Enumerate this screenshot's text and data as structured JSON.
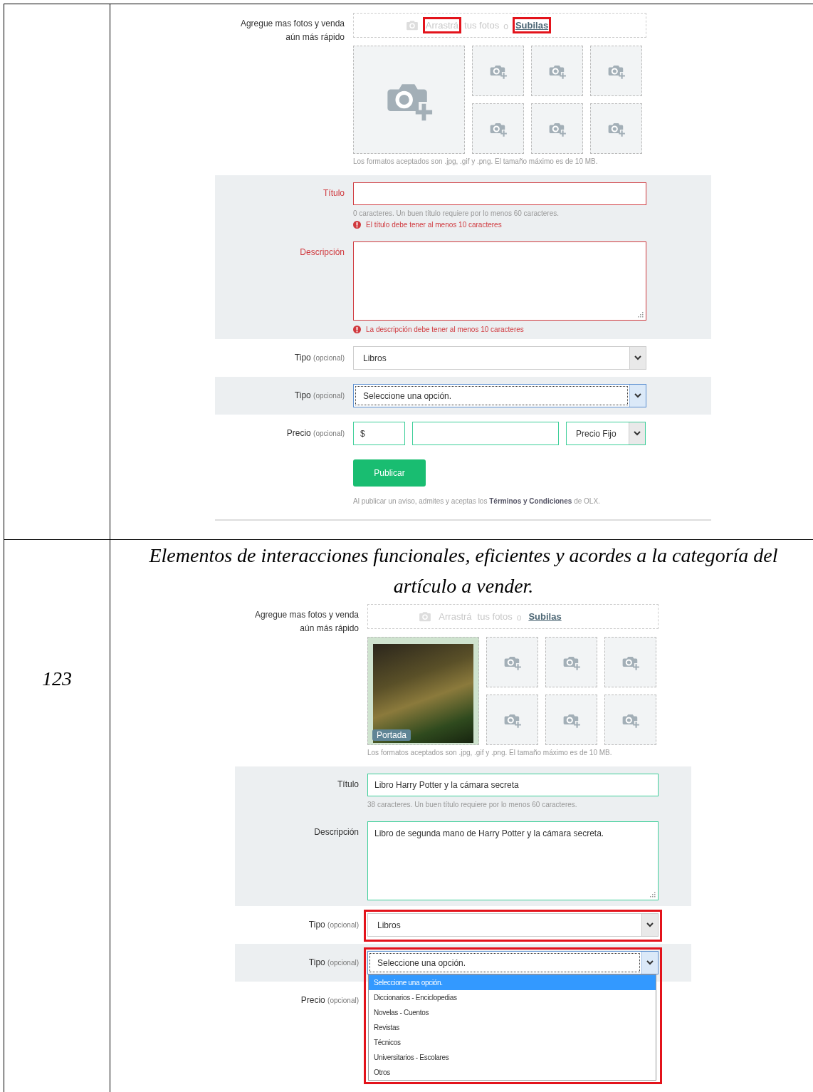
{
  "table": {
    "rows": [
      {
        "form": {
          "photos": {
            "label": "Agregue mas fotos y venda aún más rápido",
            "drop_word": "Arrastrá",
            "drop_rest": "tus fotos",
            "drop_highlighted": true,
            "or": "o",
            "upload_link": "Subilas",
            "upload_highlighted": true,
            "slots": [
              {
                "kind": "empty"
              },
              {
                "kind": "empty"
              },
              {
                "kind": "empty"
              },
              {
                "kind": "empty"
              },
              {
                "kind": "empty"
              },
              {
                "kind": "empty"
              },
              {
                "kind": "empty"
              }
            ],
            "hint": "Los formatos aceptados son .jpg, .gif y .png. El tamaño máximo es de 10 MB."
          },
          "title": {
            "label": "Título",
            "invalid": true,
            "counter": "0 caracteres. Un buen título requiere por lo menos 60 caracteres.",
            "error": "El título debe tener al menos 10 caracteres"
          },
          "description": {
            "label": "Descripción",
            "invalid": true,
            "error": "La descripción debe tener al menos 10 caracteres"
          },
          "type": {
            "label": "Tipo",
            "optional": "(opcional)",
            "value": "Libros",
            "highlighted": false,
            "focused": false
          },
          "subtype": {
            "label": "Tipo",
            "optional": "(opcional)",
            "value": "Seleccione una opción.",
            "highlighted": false,
            "focused": true
          },
          "price": {
            "label": "Precio",
            "optional": "(opcional)",
            "currency": "$",
            "mode": "Precio Fijo"
          },
          "publish": "Publicar",
          "terms": "Al publicar un aviso, admites y aceptas los **Términos y Condiciones** de OLX."
        }
      },
      {
        "number": "123",
        "caption": "Elementos de interacciones funcionales, eficientes y acordes a la categoría del artículo a vender.",
        "form": {
          "photos": {
            "label": "Agregue mas fotos y venda aún más rápido",
            "drop_word": "Arrastrá",
            "drop_rest": "tus fotos",
            "drop_highlighted": false,
            "or": "o",
            "upload_link": "Subilas",
            "upload_highlighted": false,
            "slots": [
              {
                "kind": "photo",
                "badge": "Portada"
              },
              {
                "kind": "empty"
              },
              {
                "kind": "empty"
              },
              {
                "kind": "empty"
              },
              {
                "kind": "empty"
              },
              {
                "kind": "empty"
              },
              {
                "kind": "empty"
              }
            ],
            "hint": "Los formatos aceptados son .jpg, .gif y .png. El tamaño máximo es de 10 MB."
          },
          "title": {
            "label": "Título",
            "invalid": false,
            "value": "Libro Harry Potter y la cámara secreta",
            "counter": "38 caracteres. Un buen título requiere por lo menos 60 caracteres."
          },
          "description": {
            "label": "Descripción",
            "invalid": false,
            "value": "Libro de segunda mano de Harry Potter y la cámara secreta."
          },
          "type": {
            "label": "Tipo",
            "optional": "(opcional)",
            "value": "Libros",
            "highlighted": true,
            "focused": false
          },
          "subtype": {
            "label": "Tipo",
            "optional": "(opcional)",
            "value": "Seleccione una opción.",
            "highlighted": true,
            "focused": true,
            "expanded": true,
            "options": [
              {
                "label": "Seleccione una opción.",
                "selected": true
              },
              {
                "label": "Diccionarios - Enciclopedias",
                "selected": false
              },
              {
                "label": "Novelas - Cuentos",
                "selected": false
              },
              {
                "label": "Revistas",
                "selected": false
              },
              {
                "label": "Técnicos",
                "selected": false
              },
              {
                "label": "Universitarios - Escolares",
                "selected": false
              },
              {
                "label": "Otros",
                "selected": false
              }
            ]
          },
          "price": {
            "label": "Precio",
            "optional": "(opcional)"
          }
        }
      }
    ]
  }
}
